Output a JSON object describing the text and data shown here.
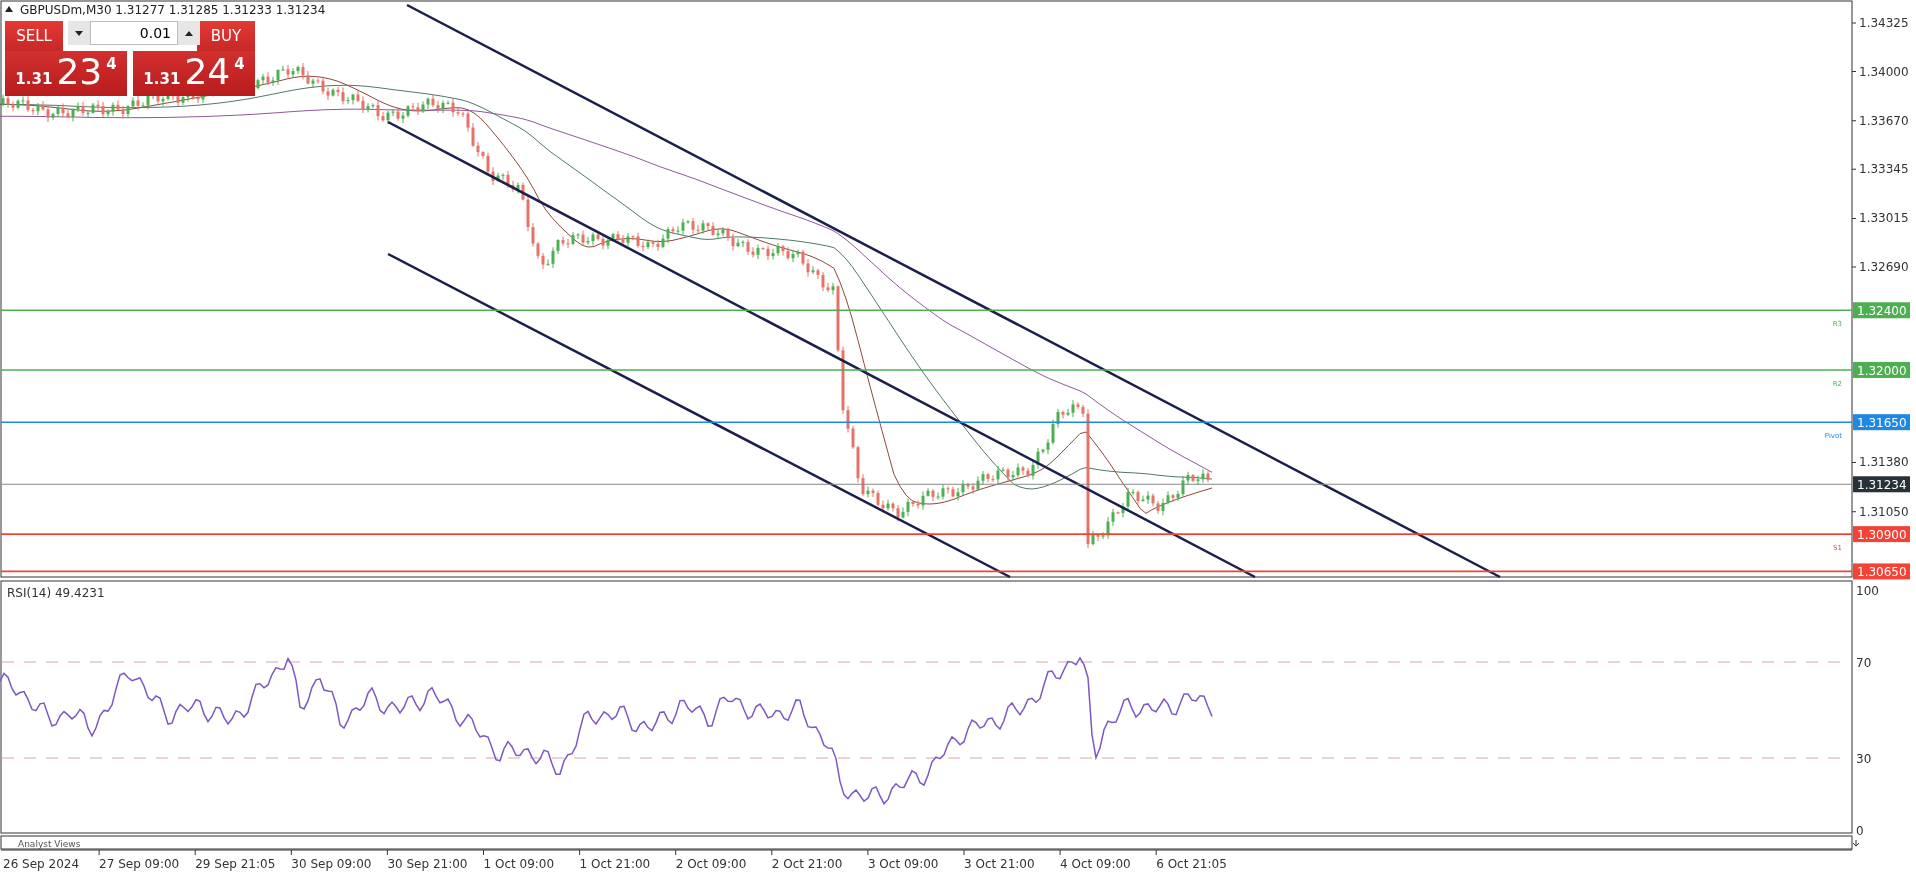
{
  "chart": {
    "symbol": "GBPUSDm,M30",
    "ohlc": [
      "1.31277",
      "1.31285",
      "1.31233",
      "1.31234"
    ]
  },
  "trade_panel": {
    "sell_label": "SELL",
    "buy_label": "BUY",
    "lot": "0.01",
    "sell_price": {
      "prefix": "1.31",
      "pips": "23",
      "fraction": "4"
    },
    "buy_price": {
      "prefix": "1.31",
      "pips": "24",
      "fraction": "4"
    }
  },
  "price_axis": {
    "ticks": [
      "1.34325",
      "1.34000",
      "1.33670",
      "1.33345",
      "1.33015",
      "1.32690",
      "1.31380",
      "1.31050"
    ]
  },
  "levels": [
    {
      "price": "1.32400",
      "name": "R3",
      "color": "#4caf50"
    },
    {
      "price": "1.32000",
      "name": "R2",
      "color": "#4caf50"
    },
    {
      "price": "1.31650",
      "name": "Pivot",
      "color": "#1e88e5"
    },
    {
      "price": "1.30900",
      "name": "S1",
      "color": "#f44336"
    },
    {
      "price": "1.30650",
      "color": "#f44336"
    }
  ],
  "last_price": {
    "price": "1.31234"
  },
  "rsi": {
    "title": "RSI(14) 49.4231",
    "ticks": [
      "100",
      "70",
      "30",
      "0"
    ]
  },
  "analyst_views": {
    "title": "Analyst Views"
  },
  "time_axis": {
    "labels": [
      "26 Sep 2024",
      "27 Sep 09:00",
      "29 Sep 21:05",
      "30 Sep 09:00",
      "30 Sep 21:00",
      "1 Oct 09:00",
      "1 Oct 21:00",
      "2 Oct 09:00",
      "2 Oct 21:00",
      "3 Oct 09:00",
      "3 Oct 21:00",
      "4 Oct 09:00",
      "6 Oct 21:05"
    ]
  }
}
